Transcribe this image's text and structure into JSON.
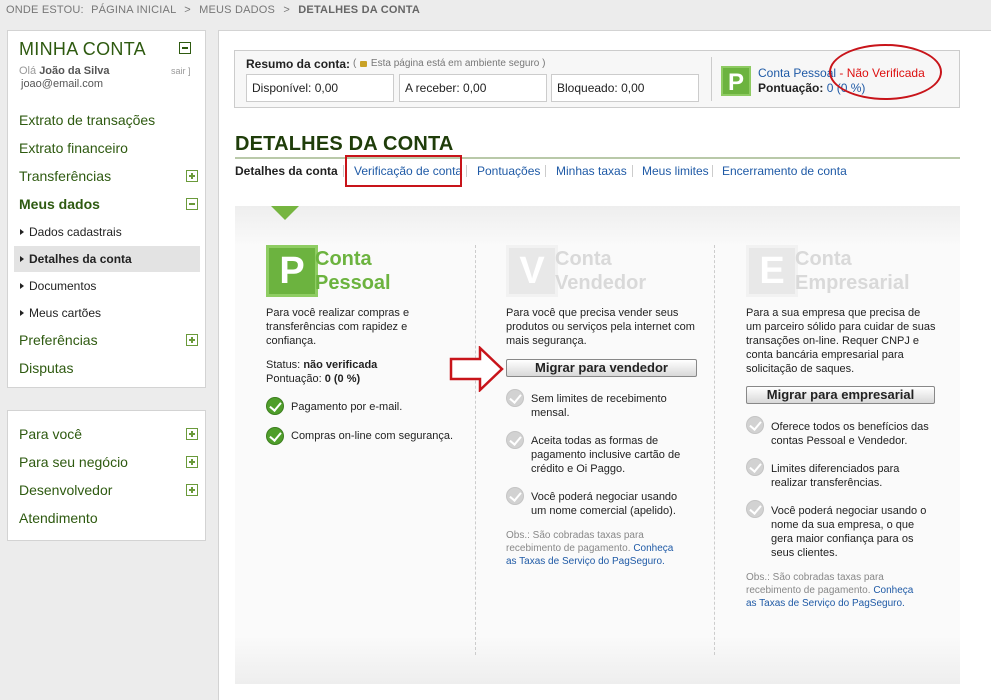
{
  "breadcrumb": {
    "prefix": "ONDE ESTOU:",
    "items": [
      "PÁGINA INICIAL",
      "MEUS DADOS"
    ],
    "current": "DETALHES DA CONTA"
  },
  "sidebar": {
    "title": "MINHA CONTA",
    "greeting_prefix": "Olá",
    "user_name": "João da Silva",
    "logout": "sair ]",
    "email": "joao@email.com",
    "items": [
      {
        "label": "Extrato de transações"
      },
      {
        "label": "Extrato financeiro"
      },
      {
        "label": "Transferências"
      },
      {
        "label": "Meus dados"
      }
    ],
    "subitems": [
      {
        "label": "Dados cadastrais"
      },
      {
        "label": "Detalhes da conta"
      },
      {
        "label": "Documentos"
      },
      {
        "label": "Meus cartões"
      }
    ],
    "items_after": [
      {
        "label": "Preferências"
      },
      {
        "label": "Disputas"
      }
    ],
    "secondary": [
      {
        "label": "Para você"
      },
      {
        "label": "Para seu negócio"
      },
      {
        "label": "Desenvolvedor"
      },
      {
        "label": "Atendimento"
      }
    ]
  },
  "summary": {
    "title": "Resumo da conta:",
    "secure_note_open": "(",
    "secure_note": "Esta página está em ambiente seguro )",
    "boxes": [
      {
        "label": "Disponível:",
        "value": "0,00"
      },
      {
        "label": "A receber:",
        "value": "0,00"
      },
      {
        "label": "Bloqueado:",
        "value": "0,00"
      }
    ],
    "account_badge": "P",
    "account_type": "Conta Pessoal",
    "account_status": " - Não Verificada",
    "score_label": "Pontuação:",
    "score_value": "0 (0 %)"
  },
  "page_title": "DETALHES DA CONTA",
  "tabs": [
    {
      "label": "Detalhes da conta"
    },
    {
      "label": "Verificação de conta"
    },
    {
      "label": "Pontuações"
    },
    {
      "label": "Minhas taxas"
    },
    {
      "label": "Meus limites"
    },
    {
      "label": "Encerramento de conta"
    }
  ],
  "cards": {
    "pessoal": {
      "badge": "P",
      "title1": "Conta",
      "title2": "Pessoal",
      "desc": [
        "Para você realizar compras e",
        "transferências com rapidez e",
        "confiança."
      ],
      "status_label": "Status:",
      "status_value": "não verificada",
      "score_label": "Pontuação:",
      "score_value": "0 (0 %)",
      "features": [
        [
          "Pagamento por e-mail."
        ],
        [
          "Compras on-line com segurança."
        ]
      ]
    },
    "vendedor": {
      "badge": "V",
      "title1": "Conta",
      "title2": "Vendedor",
      "desc": [
        "Para você que precisa vender seus",
        "produtos ou serviços pela internet com",
        "mais segurança."
      ],
      "button": "Migrar para vendedor",
      "features": [
        [
          "Sem limites de recebimento",
          "mensal."
        ],
        [
          "Aceita todas as formas de",
          "pagamento inclusive cartão de",
          "crédito e Oi Paggo."
        ],
        [
          "Você poderá negociar usando",
          "um nome comercial (apelido)."
        ]
      ],
      "obs_line1": "Obs.: São cobradas taxas para",
      "obs_line2_text": "recebimento de pagamento.",
      "obs_link1": "Conheça",
      "obs_link2": "as Taxas de Serviço do PagSeguro."
    },
    "empresarial": {
      "badge": "E",
      "title1": "Conta",
      "title2": "Empresarial",
      "desc": [
        "Para a sua empresa que precisa de",
        "um parceiro sólido para cuidar de suas",
        "transações on-line. Requer CNPJ e",
        "conta bancária empresarial para",
        "solicitação de saques."
      ],
      "button": "Migrar para empresarial",
      "features": [
        [
          "Oferece todos os benefícios das",
          "contas Pessoal e Vendedor."
        ],
        [
          "Limites diferenciados para",
          "realizar transferências."
        ],
        [
          "Você poderá negociar usando o",
          "nome da sua empresa, o que",
          "gera maior confiança para os",
          "seus clientes."
        ]
      ],
      "obs_line1": "Obs.: São cobradas taxas para",
      "obs_line2_text": "recebimento de pagamento.",
      "obs_link1": "Conheça",
      "obs_link2": "as Taxas de Serviço do PagSeguro."
    }
  },
  "colors": {
    "brand_green": "#6cb33f",
    "dark_green": "#2e5a10",
    "link_blue": "#1f5aa6",
    "annotation_red": "#c8141a"
  }
}
